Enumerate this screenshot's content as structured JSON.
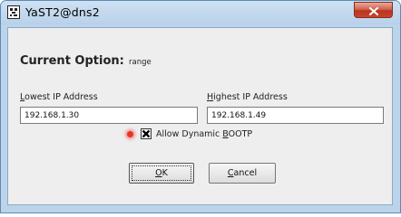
{
  "window": {
    "title": "YaST2@dns2",
    "app_icon": "yast-app-icon",
    "close_icon": "close-icon"
  },
  "current_option": {
    "label": "Current Option:",
    "value": "range"
  },
  "lowest_ip": {
    "label_pre": "",
    "label_mnemonic": "L",
    "label_post": "owest IP Address",
    "value": "192.168.1.30"
  },
  "highest_ip": {
    "label_pre": "",
    "label_mnemonic": "H",
    "label_post": "ighest IP Address",
    "value": "192.168.1.49"
  },
  "dynamic_bootp": {
    "checked": true,
    "label_pre": "Allow Dynamic ",
    "label_mnemonic": "B",
    "label_post": "OOTP",
    "indicator_color": "#e8352c"
  },
  "buttons": {
    "ok": {
      "mnemonic": "O",
      "rest": "K"
    },
    "cancel": {
      "mnemonic": "C",
      "rest": "ancel"
    }
  },
  "colors": {
    "titlebar": "#bcd4ea",
    "close_button": "#c9442d",
    "client_bg": "#eeeeee"
  }
}
